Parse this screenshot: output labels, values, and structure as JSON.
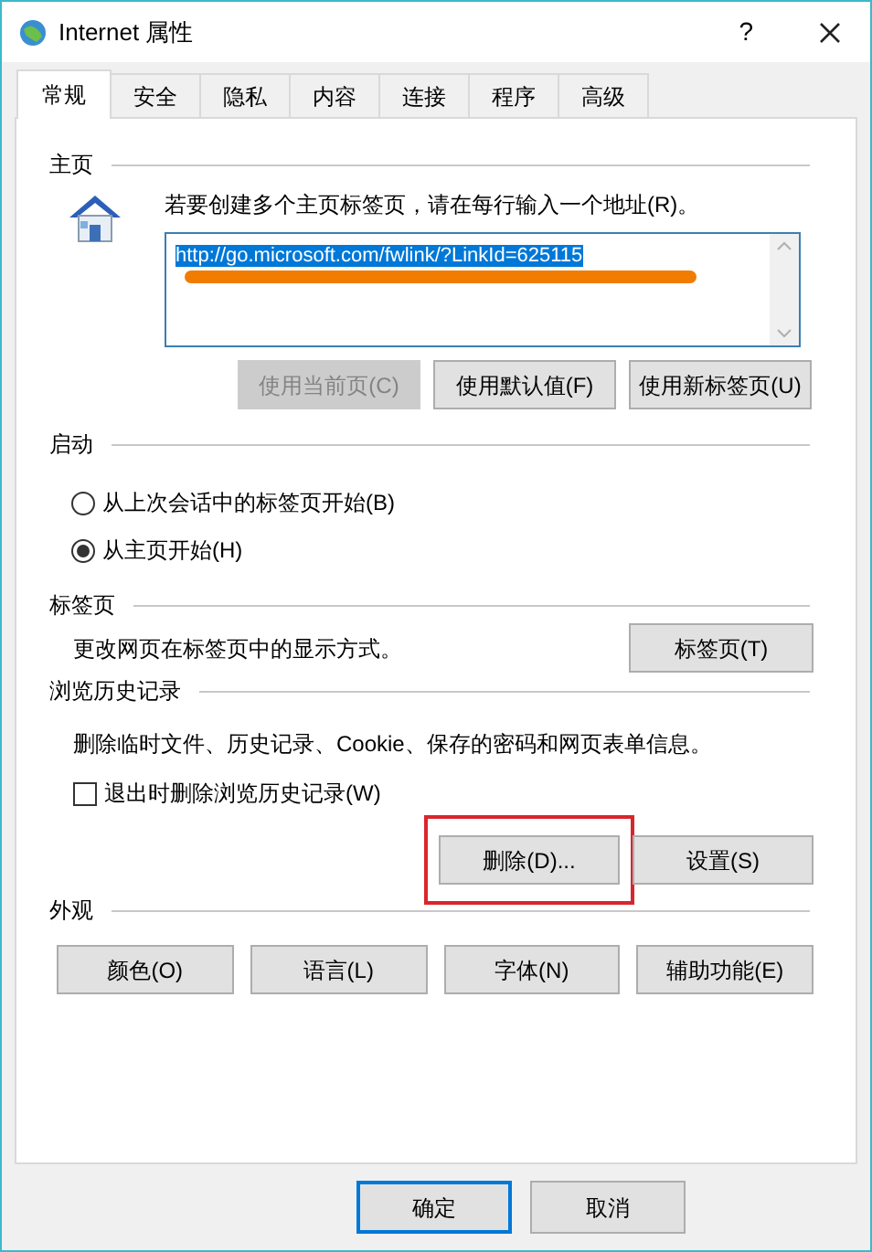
{
  "window": {
    "title": "Internet 属性",
    "help": "?"
  },
  "tabs": [
    {
      "label": "常规",
      "selected": true
    },
    {
      "label": "安全",
      "selected": false
    },
    {
      "label": "隐私",
      "selected": false
    },
    {
      "label": "内容",
      "selected": false
    },
    {
      "label": "连接",
      "selected": false
    },
    {
      "label": "程序",
      "selected": false
    },
    {
      "label": "高级",
      "selected": false
    }
  ],
  "home_page": {
    "heading": "主页",
    "instruction": "若要创建多个主页标签页，请在每行输入一个地址(R)。",
    "url": "http://go.microsoft.com/fwlink/?LinkId=625115",
    "url_selected": true,
    "url_marked": true,
    "buttons": [
      {
        "label": "使用当前页(C)",
        "disabled": true,
        "highlighted": false
      },
      {
        "label": "使用默认值(F)",
        "disabled": false,
        "highlighted": false
      },
      {
        "label": "使用新标签页(U)",
        "disabled": false,
        "highlighted": false
      }
    ]
  },
  "startup": {
    "heading": "启动",
    "options": [
      {
        "label": "从上次会话中的标签页开始(B)",
        "selected": false
      },
      {
        "label": "从主页开始(H)",
        "selected": true
      }
    ]
  },
  "tabs_section": {
    "heading": "标签页",
    "description": "更改网页在标签页中的显示方式。",
    "button": {
      "label": "标签页(T)",
      "disabled": false,
      "highlighted": false
    }
  },
  "browsing_history": {
    "heading": "浏览历史记录",
    "description": "删除临时文件、历史记录、Cookie、保存的密码和网页表单信息。",
    "checkbox": {
      "label": "退出时删除浏览历史记录(W)",
      "checked": false
    },
    "buttons": [
      {
        "label": "删除(D)...",
        "disabled": false,
        "highlighted": true
      },
      {
        "label": "设置(S)",
        "disabled": false,
        "highlighted": false
      }
    ]
  },
  "appearance": {
    "heading": "外观",
    "buttons": [
      {
        "label": "颜色(O)",
        "disabled": false,
        "highlighted": false
      },
      {
        "label": "语言(L)",
        "disabled": false,
        "highlighted": false
      },
      {
        "label": "字体(N)",
        "disabled": false,
        "highlighted": false
      },
      {
        "label": "辅助功能(E)",
        "disabled": false,
        "highlighted": false
      }
    ]
  },
  "footer": [
    {
      "label": "确定",
      "default": true
    },
    {
      "label": "取消",
      "default": false
    }
  ]
}
